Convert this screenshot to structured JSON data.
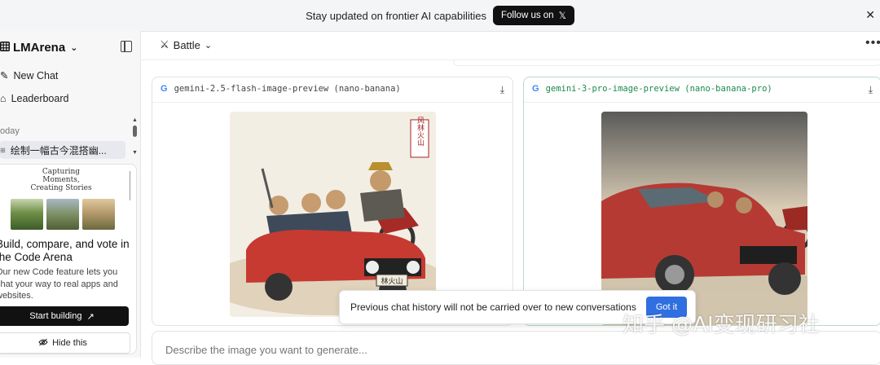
{
  "banner": {
    "message": "Stay updated on frontier AI capabilities",
    "follow_label": "Follow us on",
    "follow_icon": "x-logo-icon",
    "close_icon": "close-icon"
  },
  "sidebar": {
    "brand": "LMArena",
    "nav": [
      {
        "label": "New Chat",
        "icon": "new-chat-icon"
      },
      {
        "label": "Leaderboard",
        "icon": "leaderboard-icon"
      }
    ],
    "section_label": "oday",
    "chat_item": "绘制一幅古今混搭幽...",
    "promo": {
      "preview_title": "Capturing Moments, Creating Stories",
      "heading": "Build, compare, and vote in the Code Arena",
      "body": "Our new Code feature lets you chat your way to real apps and websites.",
      "start_label": "Start building",
      "hide_label": "Hide this"
    }
  },
  "main": {
    "mode": "Battle",
    "more_icon": "more-horizontal-icon",
    "panels": [
      {
        "model": "gemini-2.5-flash-image-preview (nano-banana)",
        "image_seal": "风林火山",
        "plate": "林火山"
      },
      {
        "model": "gemini-3-pro-image-preview (nano-banana-pro)"
      }
    ],
    "toast": {
      "message": "Previous chat history will not be carried over to new conversations",
      "button": "Got it"
    },
    "input_placeholder": "Describe the image you want to generate...",
    "watermark": "知乎 @AI变现研习社"
  },
  "colors": {
    "accent_blue": "#2f6fe0",
    "model_green": "#1a8a4a",
    "dark": "#111111"
  }
}
